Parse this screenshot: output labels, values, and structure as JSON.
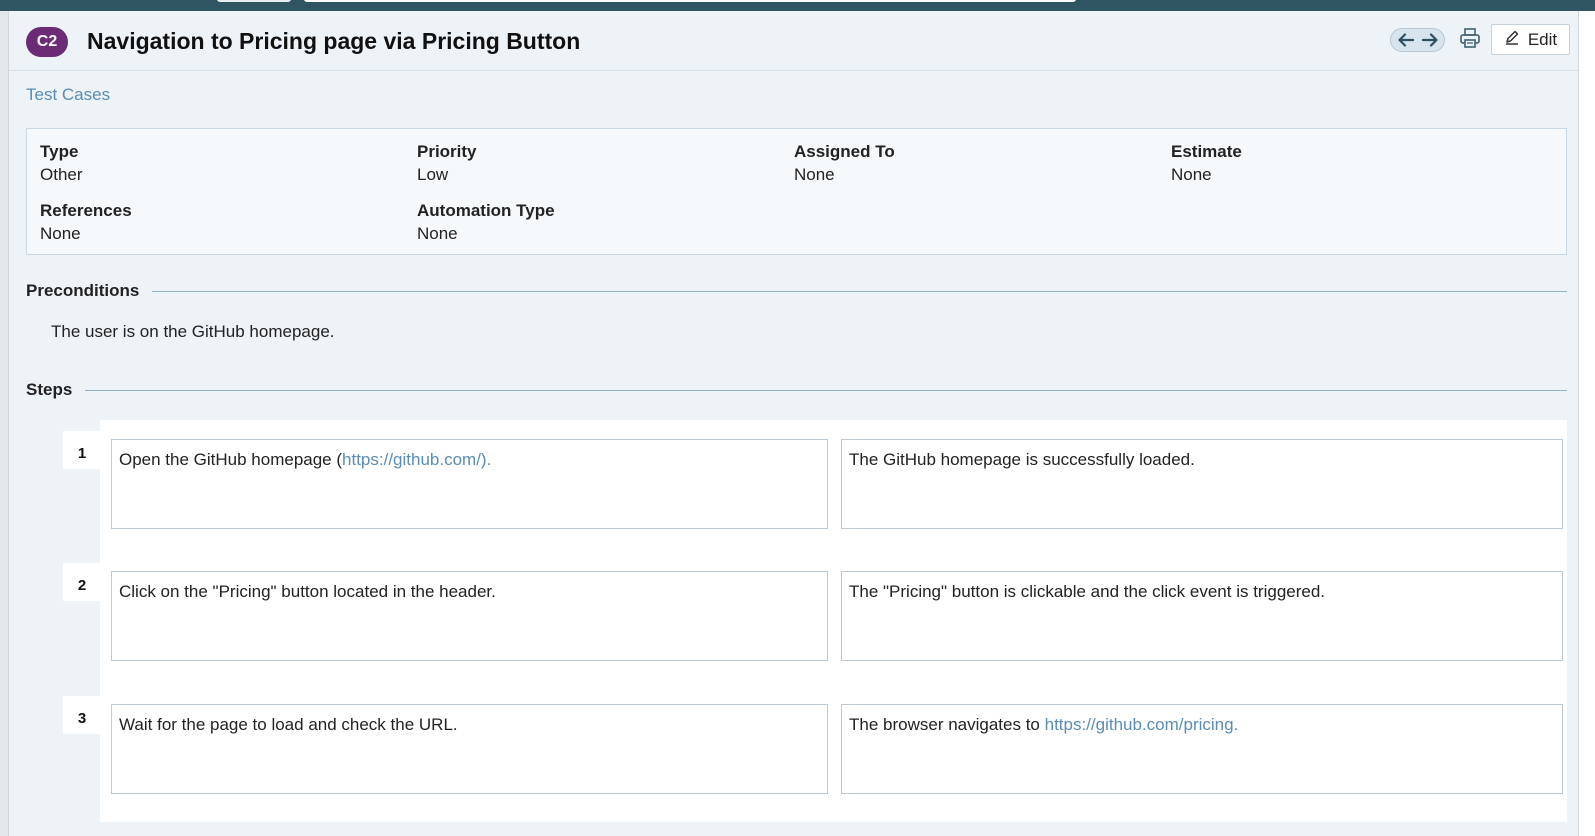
{
  "header": {
    "case_id": "C2",
    "title": "Navigation to Pricing page via Pricing Button",
    "edit_label": "Edit"
  },
  "breadcrumb": "Test Cases",
  "fields": {
    "type": {
      "label": "Type",
      "value": "Other"
    },
    "priority": {
      "label": "Priority",
      "value": "Low"
    },
    "assigned_to": {
      "label": "Assigned To",
      "value": "None"
    },
    "estimate": {
      "label": "Estimate",
      "value": "None"
    },
    "references": {
      "label": "References",
      "value": "None"
    },
    "automation_type": {
      "label": "Automation Type",
      "value": "None"
    }
  },
  "preconditions": {
    "heading": "Preconditions",
    "text": "The user is on the GitHub homepage."
  },
  "steps": {
    "heading": "Steps",
    "items": [
      {
        "number": "1",
        "action_text": "Open the GitHub homepage (",
        "action_link": "https://github.com/).",
        "expected_text": "The GitHub homepage is successfully loaded.",
        "expected_link": ""
      },
      {
        "number": "2",
        "action_text": "Click on the \"Pricing\" button located in the header.",
        "action_link": "",
        "expected_text": "The \"Pricing\" button is clickable and the click event is triggered.",
        "expected_link": ""
      },
      {
        "number": "3",
        "action_text": "Wait for the page to load and check the URL.",
        "action_link": "",
        "expected_text": "The browser navigates to ",
        "expected_link": "https://github.com/pricing."
      }
    ]
  },
  "colors": {
    "badge": "#6b2b75",
    "link": "#5a8db5",
    "topbar": "#2f5563",
    "rule": "#8fb1c4"
  },
  "icons": {
    "prev": "arrow-left-icon",
    "next": "arrow-right-icon",
    "print": "printer-icon",
    "edit": "pencil-icon"
  }
}
